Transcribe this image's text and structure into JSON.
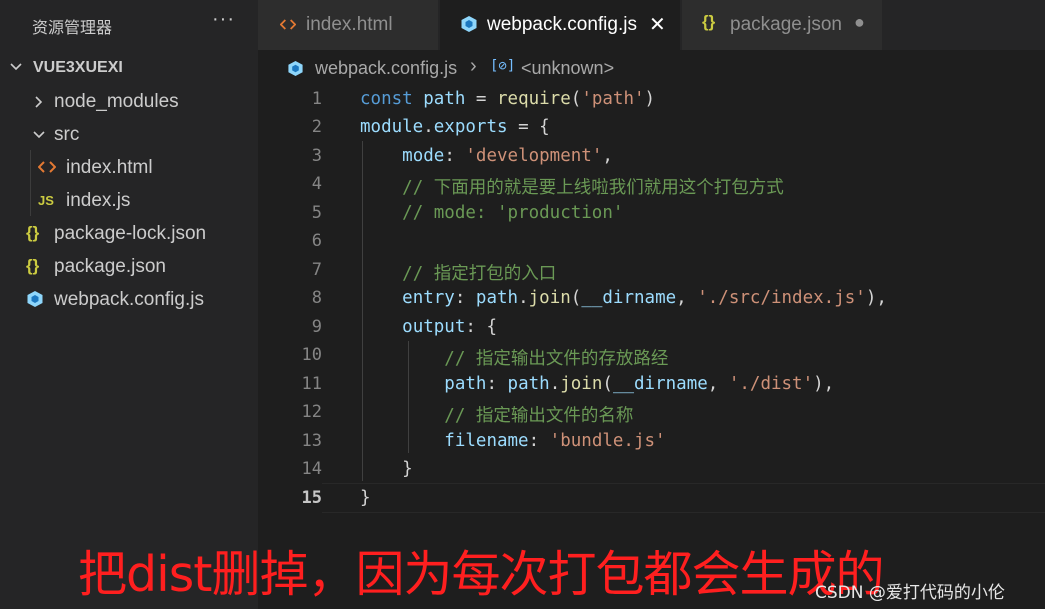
{
  "sidebar": {
    "title": "资源管理器",
    "more": "···",
    "project": "VUE3XUEXI",
    "items": [
      {
        "label": "node_modules",
        "icon": "chevron-right-icon"
      },
      {
        "label": "src",
        "icon": "chevron-down-icon"
      },
      {
        "label": "index.html",
        "icon": "html-file-icon"
      },
      {
        "label": "index.js",
        "icon": "js-file-icon",
        "badge": "JS"
      },
      {
        "label": "package-lock.json",
        "icon": "json-file-icon",
        "badge": "{}"
      },
      {
        "label": "package.json",
        "icon": "json-file-icon",
        "badge": "{}"
      },
      {
        "label": "webpack.config.js",
        "icon": "webpack-file-icon"
      }
    ]
  },
  "tabs": [
    {
      "label": "index.html",
      "icon": "html-file-icon",
      "active": false
    },
    {
      "label": "webpack.config.js",
      "icon": "webpack-file-icon",
      "active": true,
      "close": "✕"
    },
    {
      "label": "package.json",
      "icon": "json-file-icon",
      "active": false,
      "modified": "●",
      "badge": "{}"
    }
  ],
  "breadcrumb": {
    "file": "webpack.config.js",
    "separator": "›",
    "symbol": "<unknown>"
  },
  "editor": {
    "current_line": 15,
    "line_numbers": [
      "1",
      "2",
      "3",
      "4",
      "5",
      "6",
      "7",
      "8",
      "9",
      "10",
      "11",
      "12",
      "13",
      "14",
      "15"
    ]
  },
  "overlay": {
    "caption": "把dist删掉，因为每次打包都会生成的",
    "watermark": "CSDN @爱打代码的小伦"
  },
  "colors": {
    "keyword": "#569cd6",
    "variable": "#9cdcfe",
    "function": "#dcdcaa",
    "string": "#ce9178",
    "comment": "#6a9955",
    "caption": "#ff1f1f"
  }
}
